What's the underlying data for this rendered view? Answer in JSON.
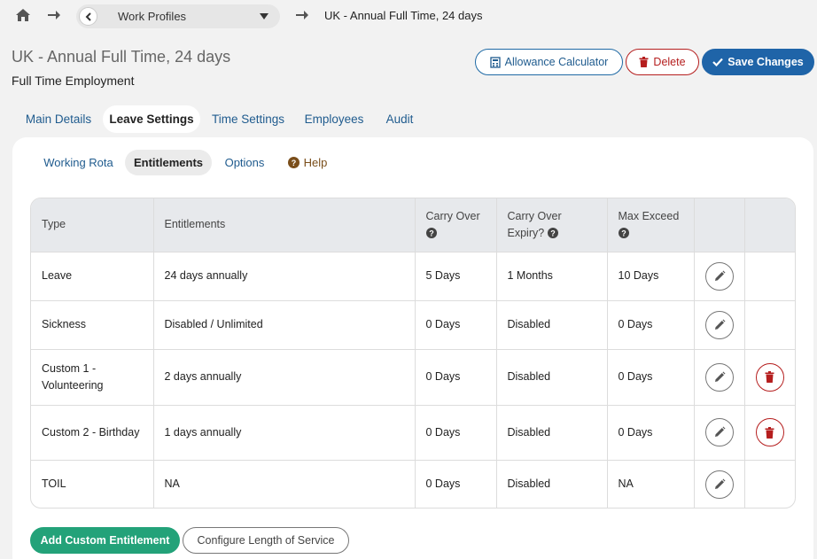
{
  "breadcrumb": {
    "dropdown_label": "Work Profiles",
    "current": "UK - Annual Full Time, 24 days"
  },
  "header": {
    "title": "UK - Annual Full Time, 24 days",
    "subtitle": "Full Time Employment",
    "calc_label": "Allowance Calculator",
    "delete_label": "Delete",
    "save_label": "Save Changes"
  },
  "main_tabs": [
    "Main Details",
    "Leave Settings",
    "Time Settings",
    "Employees",
    "Audit"
  ],
  "active_main_tab": "Leave Settings",
  "sub_tabs": {
    "working_rota": "Working Rota",
    "entitlements": "Entitlements",
    "options": "Options",
    "help": "Help"
  },
  "table": {
    "headers": {
      "type": "Type",
      "entitlements": "Entitlements",
      "carry_over": "Carry Over",
      "carry_over_expiry": "Carry Over Expiry?",
      "max_exceed": "Max Exceed"
    },
    "rows": [
      {
        "type": "Leave",
        "entitlement": "24 days annually",
        "carry_over": "5 Days",
        "expiry": "1 Months",
        "max_exceed": "10 Days",
        "deletable": false
      },
      {
        "type": "Sickness",
        "entitlement": "Disabled / Unlimited",
        "carry_over": "0 Days",
        "expiry": "Disabled",
        "max_exceed": "0 Days",
        "deletable": false
      },
      {
        "type": "Custom 1 - Volunteering",
        "entitlement": "2 days annually",
        "carry_over": "0 Days",
        "expiry": "Disabled",
        "max_exceed": "0 Days",
        "deletable": true
      },
      {
        "type": "Custom 2 - Birthday",
        "entitlement": "1 days annually",
        "carry_over": "0 Days",
        "expiry": "Disabled",
        "max_exceed": "0 Days",
        "deletable": true
      },
      {
        "type": "TOIL",
        "entitlement": "NA",
        "carry_over": "0 Days",
        "expiry": "Disabled",
        "max_exceed": "NA",
        "deletable": false
      }
    ]
  },
  "footer": {
    "add_label": "Add Custom Entitlement",
    "config_label": "Configure Length of Service"
  },
  "colors": {
    "primary": "#1f64a8",
    "danger": "#b51e1e",
    "success": "#23a279",
    "help": "#7a4e1a"
  }
}
